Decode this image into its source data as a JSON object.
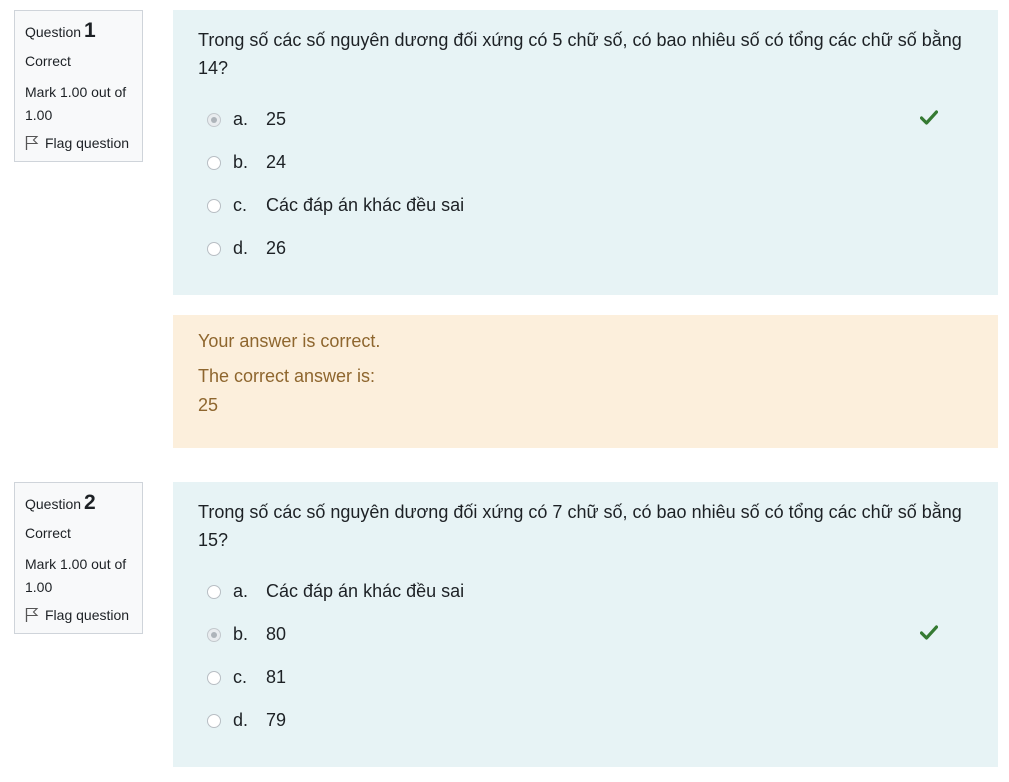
{
  "questions": [
    {
      "label": "Question",
      "number": "1",
      "state": "Correct",
      "grade": "Mark 1.00 out of 1.00",
      "flag_label": "Flag question",
      "text": "Trong số các số nguyên dương đối xứng có 5 chữ số, có bao nhiêu số có tổng các chữ số bằng 14?",
      "answers": [
        {
          "letter": "a.",
          "text": "25",
          "selected": true,
          "correct": true
        },
        {
          "letter": "b.",
          "text": "24",
          "selected": false,
          "correct": false
        },
        {
          "letter": "c.",
          "text": "Các đáp án khác đều sai",
          "selected": false,
          "correct": false
        },
        {
          "letter": "d.",
          "text": "26",
          "selected": false,
          "correct": false
        }
      ],
      "feedback": {
        "status": "Your answer is correct.",
        "correct_label": "The correct answer is:",
        "correct_value": "25"
      }
    },
    {
      "label": "Question",
      "number": "2",
      "state": "Correct",
      "grade": "Mark 1.00 out of 1.00",
      "flag_label": "Flag question",
      "text": "Trong số các số nguyên dương đối xứng có 7 chữ số, có bao nhiêu số có tổng các chữ số bằng 15?",
      "answers": [
        {
          "letter": "a.",
          "text": "Các đáp án khác đều sai",
          "selected": false,
          "correct": false
        },
        {
          "letter": "b.",
          "text": "80",
          "selected": true,
          "correct": true
        },
        {
          "letter": "c.",
          "text": "81",
          "selected": false,
          "correct": false
        },
        {
          "letter": "d.",
          "text": "79",
          "selected": false,
          "correct": false
        }
      ]
    }
  ],
  "colors": {
    "content_bg": "#e7f3f5",
    "feedback_bg": "#fcefdc",
    "feedback_text": "#8e662e",
    "check_green": "#357a32"
  },
  "icons": {
    "flag": "flag-outline-icon",
    "check": "check-mark-icon"
  }
}
